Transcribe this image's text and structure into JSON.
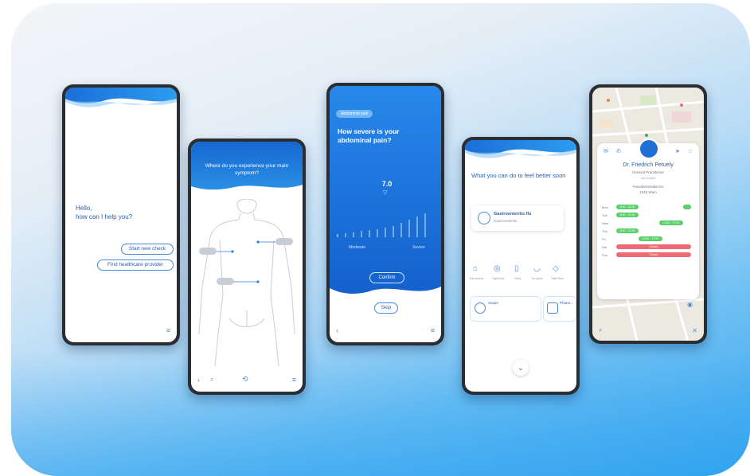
{
  "screen1": {
    "greeting": "Hello,\nhow can I help you?",
    "start_check": "Start new check",
    "find_provider": "Find healthcare provider"
  },
  "screen2": {
    "question": "Where do you experience your main symptom?"
  },
  "screen3": {
    "tag": "Abdominal pain",
    "question": "How severe is your abdominal pain?",
    "value": "7.0",
    "scale_min": "Moderate",
    "scale_max": "Severe",
    "confirm": "Confirm",
    "skip": "Skip"
  },
  "screen4": {
    "heading": "What you can do to feel better soon",
    "condition_title": "Gastroenteritis flu",
    "condition_sub": "Gastroenteritis",
    "tips": [
      "Eat normal",
      "Light food",
      "Drink",
      "No spice",
      "Take Rest"
    ],
    "card1_title": "Soups",
    "card2_title": "Pharm..."
  },
  "screen5": {
    "doctor_name": "Dr. Friedrich Petuely",
    "specialty": "General Practitioner",
    "status": "not loaded",
    "address_line1": "Favoritenstraße 6/1",
    "address_line2": "1040 Wien",
    "days": [
      "Mon",
      "Tue",
      "Wed",
      "Thu",
      "Fri",
      "Sat",
      "Sun"
    ],
    "slots": [
      "8:00 - 12:00",
      "8:00 - 12:00",
      "13:00 - 17:00",
      "8:00 - 12:00",
      "13:00 - 17:00",
      "8:00 - 12:00",
      "Closed",
      "Closed"
    ]
  }
}
